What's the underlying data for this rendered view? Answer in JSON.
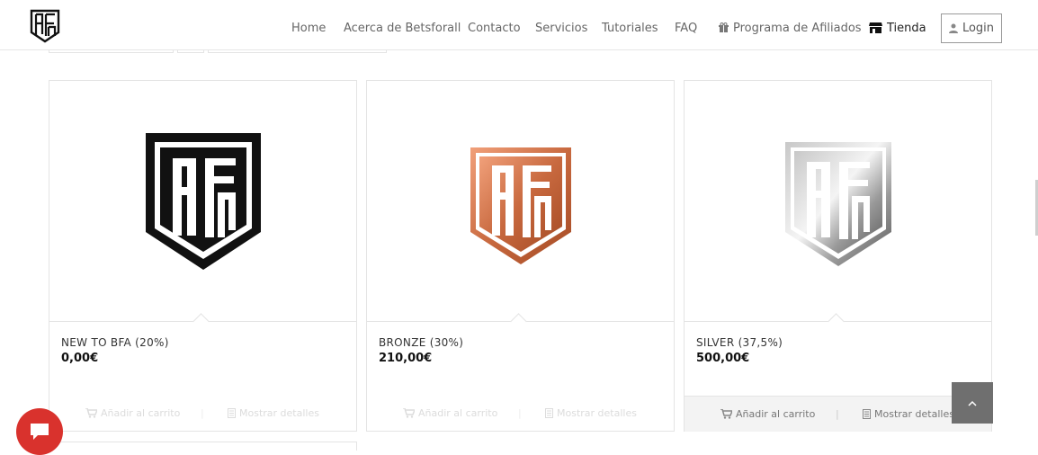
{
  "header": {
    "nav": [
      {
        "id": "home",
        "label": "Home"
      },
      {
        "id": "about",
        "label": "Acerca de Betsforall"
      },
      {
        "id": "contact",
        "label": "Contacto"
      },
      {
        "id": "services",
        "label": "Servicios"
      },
      {
        "id": "tutorials",
        "label": "Tutoriales"
      },
      {
        "id": "faq",
        "label": "FAQ"
      },
      {
        "id": "affiliates",
        "label": "Programa de Afiliados",
        "icon": "gift-icon"
      },
      {
        "id": "shop",
        "label": "Tienda",
        "icon": "store-icon"
      }
    ],
    "login_label": "Login",
    "login_icon": "user-icon",
    "logo_icon": "bfa-logo-icon"
  },
  "products": [
    {
      "title": "NEW TO BFA (20%)",
      "price": "0,00€",
      "logo_icon": "bfa-logo-black-icon",
      "logo_color": "#111111",
      "add_label": "Añadir al carrito",
      "details_label": "Mostrar detalles",
      "actions_state": "faded"
    },
    {
      "title": "BRONZE (30%)",
      "price": "210,00€",
      "logo_icon": "bfa-logo-bronze-icon",
      "logo_color": "#c8693f",
      "add_label": "Añadir al carrito",
      "details_label": "Mostrar detalles",
      "actions_state": "faded"
    },
    {
      "title": "SILVER (37,5%)",
      "price": "500,00€",
      "logo_icon": "bfa-logo-silver-icon",
      "logo_color": "#8a8a8a",
      "add_label": "Añadir al carrito",
      "details_label": "Mostrar detalles",
      "actions_state": "active"
    }
  ],
  "chat_icon": "chat-icon",
  "back_to_top_icon": "chevron-up-icon",
  "colors": {
    "chat_button": "#d9322d",
    "back_to_top": "#6f6f6f",
    "border": "#e4e4e4"
  }
}
